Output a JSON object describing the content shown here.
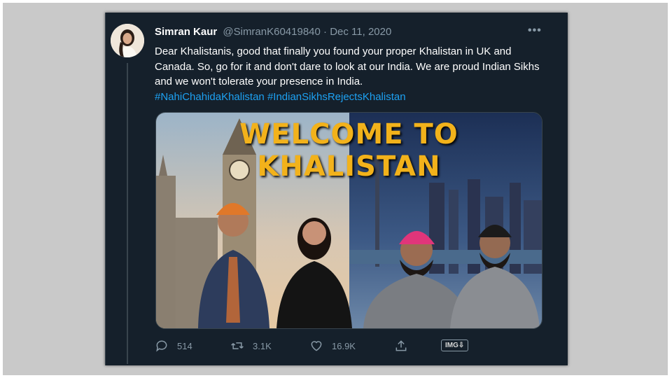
{
  "tweet": {
    "author_name": "Simran Kaur",
    "handle": "@SimranK60419840",
    "separator": "·",
    "date": "Dec 11, 2020",
    "more": "•••",
    "text": "Dear Khalistanis, good that finally you found your proper Khalistan in UK and Canada. So, go for it and don't dare to look at our India. We are proud Indian Sikhs and we won't tolerate your presence in India.",
    "hashtags": "#NahiChahidaKhalistan #IndianSikhsRejectsKhalistan",
    "media": {
      "headline": "WELCOME TO KHALISTAN"
    },
    "actions": {
      "replies": "514",
      "retweets": "3.1K",
      "likes": "16.9K"
    },
    "badge": "IMG⇩"
  },
  "colors": {
    "background": "#15202b",
    "text": "#ffffff",
    "muted": "#8899a6",
    "link": "#1da1f2",
    "headline": "#f2b21b"
  }
}
